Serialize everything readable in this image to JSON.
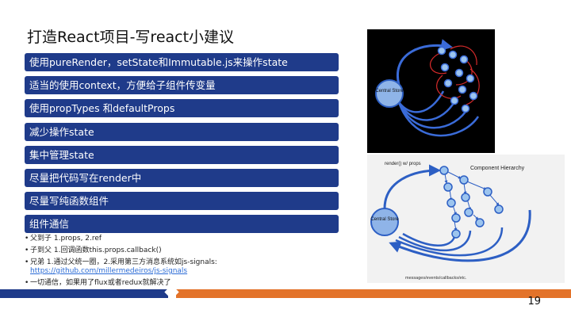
{
  "slide": {
    "title": "打造React项目-写react小建议",
    "page_number": "19"
  },
  "bars": [
    "使用pureRender，setState和Immutable.js来操作state",
    "适当的使用context，方便给子组件传变量",
    "使用propTypes 和defaultProps",
    "减少操作state",
    "集中管理state",
    "尽量把代码写在render中",
    "尽量写纯函数组件",
    "组件通信"
  ],
  "bullets": [
    {
      "text": "父到子 1.props, 2.ref"
    },
    {
      "text": "子到父 1.回调函数this.props.callback()"
    },
    {
      "text": "兄弟 1.通过父统一圈，2.采用第三方消息系统如js-signals:",
      "link": "https://github.com/millermedeiros/js-signals"
    },
    {
      "text": "一切通信，如果用了flux或者redux就解决了"
    }
  ],
  "figure_top": {
    "store_label": "Central Store"
  },
  "figure_bottom": {
    "render_label": "render() w/ props",
    "hierarchy_label": "Component Hierarchy",
    "store_label": "Central Store",
    "messages_label": "messages/events/callbacks/etc."
  },
  "colors": {
    "bar_blue": "#1f3b8a",
    "accent_orange": "#e3732a",
    "link_blue": "#2a6bd6"
  }
}
